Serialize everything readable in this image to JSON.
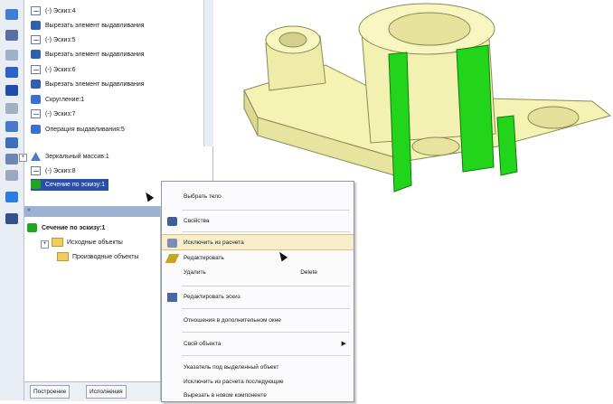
{
  "tree": {
    "items": [
      {
        "icon": "sketch-icon",
        "label": "(-) Эскиз:4"
      },
      {
        "icon": "cut-extrude-icon",
        "label": "Вырезать элемент выдавливания"
      },
      {
        "icon": "sketch-icon",
        "label": "(-) Эскиз:5"
      },
      {
        "icon": "cut-extrude-icon",
        "label": "Вырезать элемент выдавливания"
      },
      {
        "icon": "sketch-icon",
        "label": "(-) Эскиз:6"
      },
      {
        "icon": "cut-extrude-icon",
        "label": "Вырезать элемент выдавливания"
      },
      {
        "icon": "rib-icon",
        "label": "Скругление:1"
      },
      {
        "icon": "sketch-icon",
        "label": "(-) Эскиз:7"
      },
      {
        "icon": "extrude-icon",
        "label": "Операция выдавливания:5"
      },
      {
        "icon": "mirror-icon",
        "label": "Зеркальный массив:1"
      },
      {
        "icon": "sketch-icon",
        "label": "(-) Эскиз:8"
      },
      {
        "icon": "section-icon",
        "label": "Сечение по эскизу:1"
      }
    ]
  },
  "panel": {
    "title": "Сечение по эскизу:1",
    "items": [
      "Исходные объекты",
      "Производные объекты"
    ],
    "tabs": [
      "Построение",
      "Исполнения"
    ]
  },
  "menu": {
    "items": [
      {
        "label": "Выбрать тело",
        "icon": ""
      },
      {
        "label": "Свойства",
        "icon": "properties-icon"
      },
      {
        "label": "Исключить из расчета",
        "icon": "exclude-icon",
        "highlighted": true
      },
      {
        "label": "Редактировать",
        "icon": "edit-pencil-icon"
      },
      {
        "label": "Удалить",
        "shortcut": "Delete"
      },
      {
        "label": "Редактировать эскиз",
        "icon": "sketch-edit-icon"
      },
      {
        "label": "Отношения в дополнительном окне"
      },
      {
        "label": "Свой объекта",
        "submenu": true
      },
      {
        "label": "Указатель под выделенный объект"
      },
      {
        "label": "Исключить из расчета последующие"
      },
      {
        "label": "Вырезать в новом компоненте"
      }
    ]
  },
  "colors": {
    "model_face": "#f5f3b4",
    "model_shade": "#e1df9a",
    "section_face": "#22d51b",
    "selection": "#2a4fa8",
    "menu_highlight": "#f9eecb"
  }
}
